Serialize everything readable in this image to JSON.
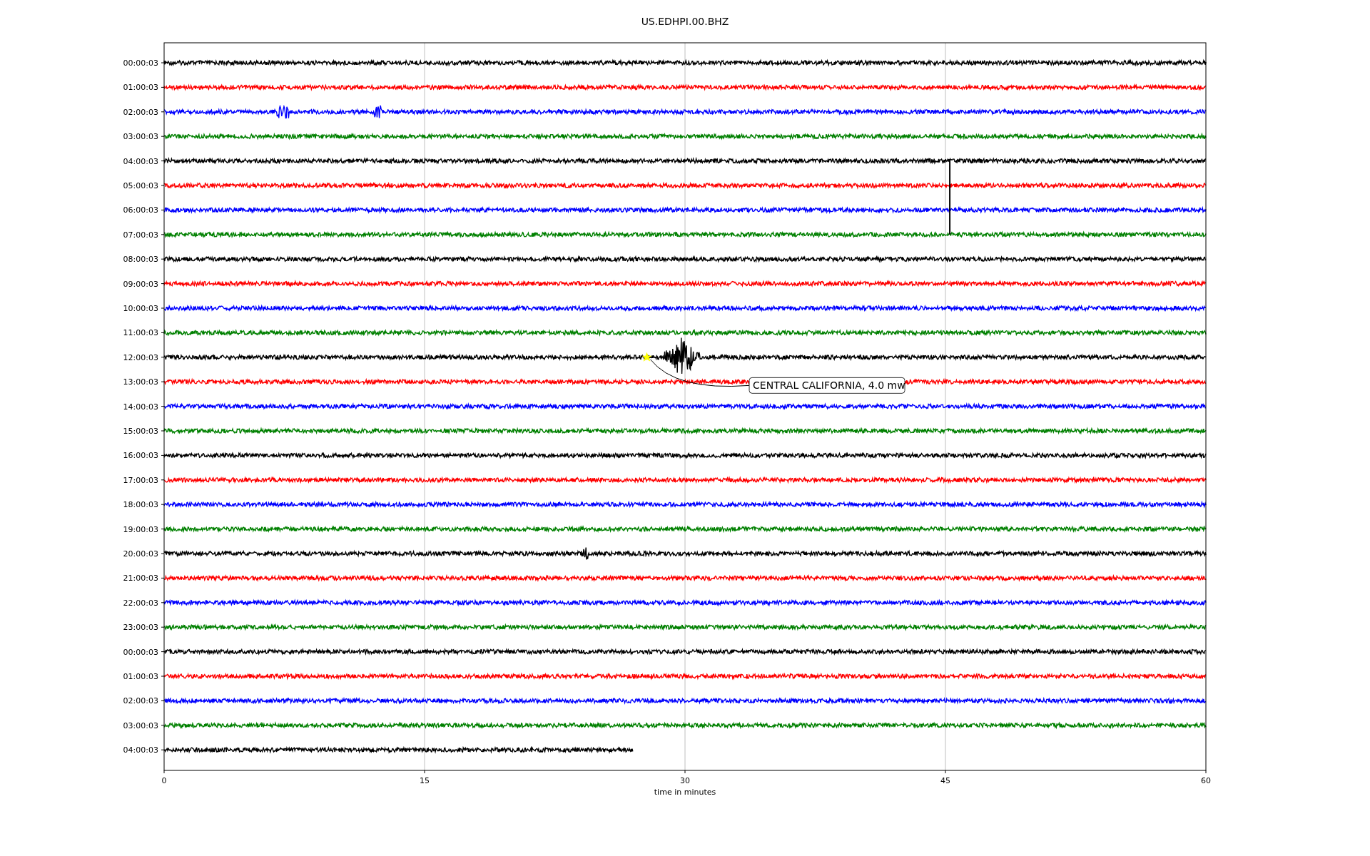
{
  "title": "US.EDHPI.00.BHZ",
  "rows": [
    {
      "label": "00:00:03",
      "color": "#000000",
      "level": 1
    },
    {
      "label": "01:00:03",
      "color": "#ff0000",
      "level": 1
    },
    {
      "label": "02:00:03",
      "color": "#0000ff",
      "level": 1
    },
    {
      "label": "03:00:03",
      "color": "#008000",
      "level": 1
    },
    {
      "label": "04:00:03",
      "color": "#000000",
      "level": 1
    },
    {
      "label": "05:00:03",
      "color": "#ff0000",
      "level": 1
    },
    {
      "label": "06:00:03",
      "color": "#0000ff",
      "level": 1
    },
    {
      "label": "07:00:03",
      "color": "#008000",
      "level": 1
    },
    {
      "label": "08:00:03",
      "color": "#000000",
      "level": 1
    },
    {
      "label": "09:00:03",
      "color": "#ff0000",
      "level": 1
    },
    {
      "label": "10:00:03",
      "color": "#0000ff",
      "level": 1
    },
    {
      "label": "11:00:03",
      "color": "#008000",
      "level": 1
    },
    {
      "label": "12:00:03",
      "color": "#000000",
      "level": 1
    },
    {
      "label": "13:00:03",
      "color": "#ff0000",
      "level": 1
    },
    {
      "label": "14:00:03",
      "color": "#0000ff",
      "level": 1
    },
    {
      "label": "15:00:03",
      "color": "#008000",
      "level": 1
    },
    {
      "label": "16:00:03",
      "color": "#000000",
      "level": 1
    },
    {
      "label": "17:00:03",
      "color": "#ff0000",
      "level": 1
    },
    {
      "label": "18:00:03",
      "color": "#0000ff",
      "level": 1
    },
    {
      "label": "19:00:03",
      "color": "#008000",
      "level": 1
    },
    {
      "label": "20:00:03",
      "color": "#000000",
      "level": 1
    },
    {
      "label": "21:00:03",
      "color": "#ff0000",
      "level": 1
    },
    {
      "label": "22:00:03",
      "color": "#0000ff",
      "level": 1
    },
    {
      "label": "23:00:03",
      "color": "#008000",
      "level": 1
    },
    {
      "label": "00:00:03",
      "color": "#000000",
      "level": 1
    },
    {
      "label": "01:00:03",
      "color": "#ff0000",
      "level": 1
    },
    {
      "label": "02:00:03",
      "color": "#0000ff",
      "level": 1
    },
    {
      "label": "03:00:03",
      "color": "#008000",
      "level": 1
    },
    {
      "label": "04:00:03",
      "color": "#000000",
      "level": 0.45
    }
  ],
  "xticks": [
    "0",
    "15",
    "30",
    "45",
    "60"
  ],
  "xlabel": "time in minutes",
  "annotation": "CENTRAL CALIFORNIA, 4.0 mw"
}
